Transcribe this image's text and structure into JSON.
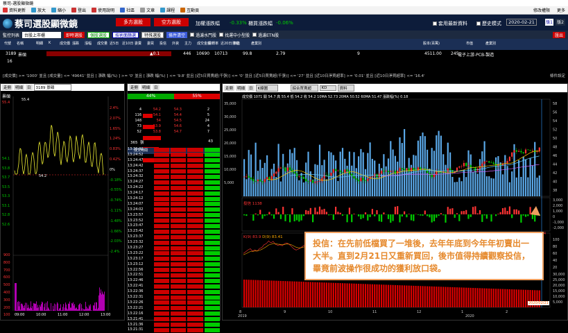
{
  "window": {
    "title": "蔡司-選股顯微鏡"
  },
  "menu": [
    "資料更新",
    "放大",
    "縮小",
    "登出",
    "使用說明",
    "社區",
    "文章",
    "課程",
    "互動頁"
  ],
  "menu_right": [
    "修改權限",
    "更多"
  ],
  "header": {
    "app_title": "蔡司選股顯微鏡",
    "long_btn": "多方選股",
    "short_btn": "空方選股",
    "rise_label": "加權漲跌幅",
    "rise_value": "-0.33%",
    "otc_label": "櫃買漲跌幅",
    "otc_value": "-0.06%",
    "chk1": "套用最新資料",
    "chk2": "歷史模式",
    "date": "2020-02-21",
    "tab1": "版1",
    "tab2": "版2"
  },
  "toolbar": {
    "watch": "監控列表",
    "market": "台股上市櫃",
    "buttons": [
      "即時選股",
      "個股選股",
      "技術面篩選",
      "特殊選股"
    ],
    "clear": "條件清空",
    "checks": [
      "過濾水門股",
      "找運中小型股",
      "過濾ETN股"
    ],
    "exit": "匯出"
  },
  "columns": [
    "代號",
    "名稱",
    "明細",
    "K",
    "成交價",
    "漲跌",
    "漲幅",
    "成交量",
    "近5日",
    "近10日",
    "委賣",
    "委買",
    "投信",
    "外資",
    "主力",
    "成交金額",
    "週轉率",
    "近20日漲幅",
    "市值",
    "產業別",
    "股本(百萬)",
    "市值",
    "產業別"
  ],
  "stock": {
    "code": "3189",
    "name": "景碩",
    "price": "446",
    "vol1": "10690",
    "vol2": "10713",
    "v99": "99.8",
    "v279": "2.79",
    "v9": "9",
    "capital": "4511.00",
    "idx": "245",
    "industry": "電子上游-PCB-製造"
  },
  "filter_text": "[成交價] >= '1000' 並且 [成交量] <= '49641' 並且 [ 漲跌 幅(%) ] >= '0' 並且 [ 漲跌 幅(%) ] <= '9.8' 並且 [近5日買賣超(千張)] <= '0' 並且 [近5日買賣超(千張)] <= '27' 並且 [近10日淨買超率] >= '0.01' 並且 [近10日淨買超率] <= '16.4'",
  "filter_right": "條件設定",
  "left_panel": {
    "tabs": [
      "走勢",
      "明細",
      "日"
    ],
    "stock_box": "3189 景碩",
    "title": "景碩",
    "high": "55.4",
    "low": "54.2",
    "ref": "16",
    "price_labels": [
      "55.4",
      "",
      "",
      "",
      "",
      "",
      "54.1",
      "53.8",
      "53.7",
      "53.5",
      "53.3",
      "53.1",
      "52.8",
      "52.6"
    ],
    "pct_labels": [
      "2.4%",
      "2.07%",
      "1.65%",
      "1.24%",
      "0.83%",
      "0.42%",
      "0%",
      "-0.18%",
      "-0.55%",
      "-0.74%",
      "-1.11%",
      "-1.48%",
      "-1.66%",
      "-2.03%",
      "-2.4%"
    ],
    "vol_labels": [
      "900",
      "800",
      "700",
      "600",
      "500",
      "400",
      "300",
      "200",
      "100"
    ],
    "times": [
      "09:00",
      "10:00",
      "11:00",
      "12:00",
      "13:00"
    ]
  },
  "mid_panel": {
    "tabs": [
      "走勢",
      "明細",
      "日"
    ],
    "buy_pct": "44%",
    "sell_pct": "55%",
    "depth": [
      [
        "4",
        "54.2",
        "54.3",
        "2"
      ],
      [
        "116",
        "54.1",
        "54.4",
        "5"
      ],
      [
        "148",
        "54",
        "54.5",
        "24"
      ],
      [
        "73",
        "53.9",
        "54.6",
        "4"
      ],
      [
        "52",
        "53.8",
        "54.7",
        "7"
      ]
    ],
    "vol_label": "365",
    "vol_unit": "張",
    "count": "43",
    "cols": [
      "成交時間",
      "買價",
      "賣價",
      "成交價",
      "單量"
    ],
    "ticks": [
      "13:30:00",
      "13:24:52",
      "13:24:47",
      "13:24:42",
      "13:24:37",
      "13:24:32",
      "13:24:27",
      "13:24:22",
      "13:24:17",
      "13:24:12",
      "13:24:07",
      "13:24:02",
      "13:23:57",
      "13:23:52",
      "13:23:47",
      "13:23:42",
      "13:23:37",
      "13:23:32",
      "13:23:27",
      "13:23:22",
      "13:23:17",
      "13:23:12",
      "13:22:56",
      "13:22:51",
      "13:22:46",
      "13:22:41",
      "13:22:36",
      "13:22:31",
      "13:22:26",
      "13:22:21",
      "13:22:16",
      "13:21:41",
      "13:21:36",
      "13:21:31"
    ]
  },
  "chart": {
    "tabs": [
      "走勢",
      "明細",
      "日"
    ],
    "type_sel": "K線圖",
    "indicator_sel": "綜合買賣超",
    "kd_sel": "KD",
    "extra_sel": "資料",
    "legend": "成交價 1071 開 54.7 高 55.4 低 54.2 收 54.2  10MA 52.73  20MA 50.52  60MA 51.47  漲跌幅(%) 0.18",
    "sub1": "投信 1138",
    "sub2_k": "K(9) 83.9",
    "sub2_d": "D(9) 83.41",
    "yaxis": [
      "58",
      "56",
      "54",
      "52",
      "50",
      "48",
      "46",
      "44",
      "42",
      "40",
      "38"
    ],
    "vol_axis": [
      "35,000",
      "30,000",
      "25,000",
      "20,000",
      "15,000",
      "10,000",
      "5,000"
    ],
    "sub1_axis": [
      "3,000",
      "2,000",
      "1,000",
      "0",
      "-1,000",
      "-2,000"
    ],
    "sub1_last": "-1,181.84",
    "sub2_axis": [
      "100",
      "80",
      "60",
      "40",
      "20"
    ],
    "sub3_axis": [
      "30,000",
      "25,000",
      "20,000",
      "15,000",
      "10,000",
      "5,000"
    ],
    "xaxis": [
      "8",
      "9",
      "10",
      "11",
      "12",
      "1",
      "2"
    ],
    "years": [
      "2019",
      "2020"
    ],
    "date_tag": "2020/02/21"
  },
  "callout": "投信：在先前低檔買了一堆後，去年年底到今年年初賣出一大半。直到2月21日又重新買回，後市值得持續觀察投信，畢竟前波操作很成功的獲利放口袋。"
}
